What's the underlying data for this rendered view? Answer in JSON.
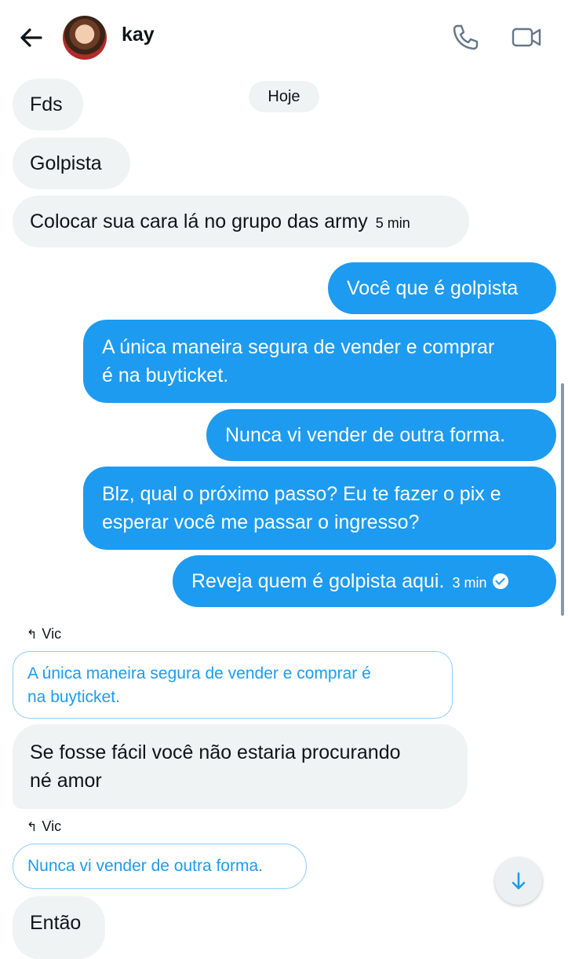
{
  "header": {
    "contact_name": "kay",
    "back_icon": "arrow-left-icon",
    "call_icon": "phone-icon",
    "video_icon": "video-camera-icon"
  },
  "date_separator": "Hoje",
  "messages": [
    {
      "direction": "incoming",
      "text": "Fds"
    },
    {
      "direction": "incoming",
      "text": "Golpista"
    },
    {
      "direction": "incoming",
      "text": "Colocar sua cara lá no grupo das army",
      "time": "5 min"
    },
    {
      "direction": "outgoing",
      "text": "Você que é golpista"
    },
    {
      "direction": "outgoing",
      "lines": [
        "A única maneira segura de vender e comprar",
        "é na buyticket."
      ]
    },
    {
      "direction": "outgoing",
      "text": "Nunca vi vender de outra forma."
    },
    {
      "direction": "outgoing",
      "lines": [
        "Blz, qual o próximo passo? Eu te fazer o pix e",
        "esperar você me passar o ingresso?"
      ]
    },
    {
      "direction": "outgoing",
      "text": "Reveja quem é golpista aqui.",
      "time": "3 min",
      "status": "read"
    },
    {
      "direction": "incoming",
      "reply_to": "Vic",
      "quoted_lines": [
        "A única maneira segura de vender e comprar é",
        "na buyticket."
      ],
      "lines": [
        "Se fosse fácil você não estaria procurando",
        "né amor"
      ]
    },
    {
      "direction": "incoming",
      "reply_to": "Vic",
      "quoted_text": "Nunca vi vender de outra forma.",
      "text": "Então"
    }
  ],
  "colors": {
    "outgoing_bubble": "#1d9bf0",
    "incoming_bubble": "#eff3f4",
    "quote_text": "#1d9bf0"
  }
}
